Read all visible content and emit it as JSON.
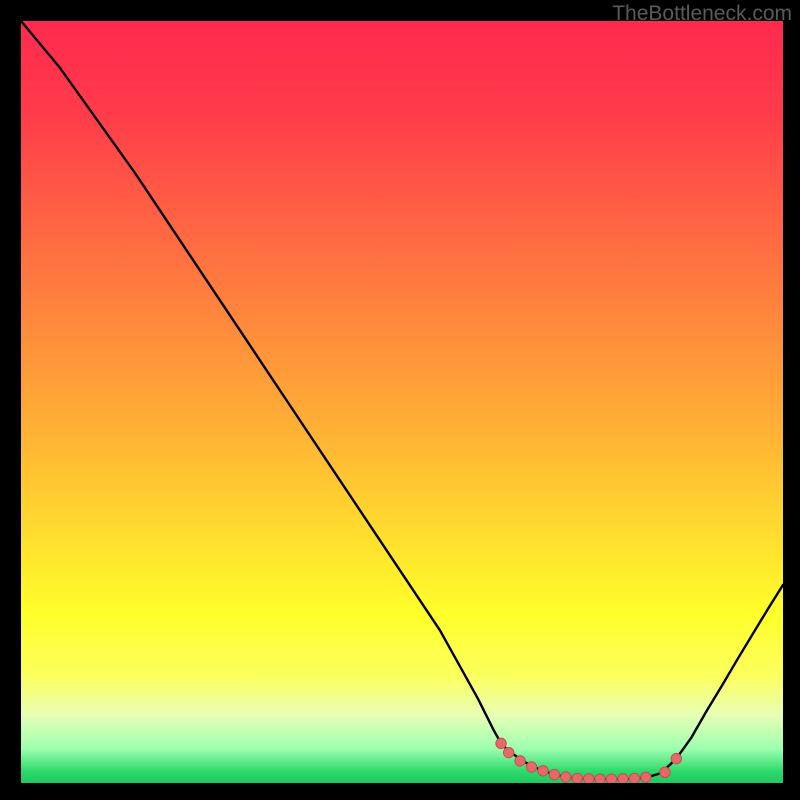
{
  "watermark": "TheBottleneck.com",
  "chart_data": {
    "type": "line",
    "title": "",
    "xlabel": "",
    "ylabel": "",
    "xlim": [
      0,
      100
    ],
    "ylim": [
      0,
      100
    ],
    "gradient_stops": [
      {
        "offset": 0.0,
        "color": "#ff2a4f"
      },
      {
        "offset": 0.12,
        "color": "#ff3b4a"
      },
      {
        "offset": 0.25,
        "color": "#ff6044"
      },
      {
        "offset": 0.4,
        "color": "#ff8a3c"
      },
      {
        "offset": 0.55,
        "color": "#ffb534"
      },
      {
        "offset": 0.68,
        "color": "#ffdf2e"
      },
      {
        "offset": 0.78,
        "color": "#ffff2a"
      },
      {
        "offset": 0.86,
        "color": "#fbff5e"
      },
      {
        "offset": 0.91,
        "color": "#e8ffb4"
      },
      {
        "offset": 0.955,
        "color": "#9cffb0"
      },
      {
        "offset": 0.985,
        "color": "#2dd96b"
      },
      {
        "offset": 1.0,
        "color": "#1fc95f"
      }
    ],
    "series": [
      {
        "name": "curve",
        "x": [
          0,
          5,
          10,
          15,
          20,
          25,
          30,
          35,
          40,
          45,
          50,
          55,
          60,
          62,
          63,
          64,
          66,
          68,
          70,
          72,
          74,
          76,
          78,
          80,
          82,
          84,
          86,
          88,
          90,
          92,
          94,
          96,
          98,
          100
        ],
        "y": [
          100,
          94,
          87,
          80,
          72.5,
          65,
          57.5,
          50,
          42.5,
          35,
          27.5,
          20,
          11,
          7,
          5.2,
          4.2,
          2.8,
          1.8,
          1.1,
          0.7,
          0.55,
          0.5,
          0.5,
          0.55,
          0.7,
          1.3,
          3.2,
          6.0,
          9.5,
          12.8,
          16.2,
          19.5,
          22.8,
          26
        ]
      }
    ],
    "markers": {
      "name": "flat-region",
      "color": "#e46a6a",
      "color_outline": "#c44e4e",
      "radius": 5.2,
      "points": [
        {
          "x": 63.0,
          "y": 5.2
        },
        {
          "x": 64.0,
          "y": 4.0
        },
        {
          "x": 65.5,
          "y": 2.9
        },
        {
          "x": 67.0,
          "y": 2.1
        },
        {
          "x": 68.5,
          "y": 1.6
        },
        {
          "x": 70.0,
          "y": 1.1
        },
        {
          "x": 71.5,
          "y": 0.8
        },
        {
          "x": 73.0,
          "y": 0.6
        },
        {
          "x": 74.5,
          "y": 0.55
        },
        {
          "x": 76.0,
          "y": 0.5
        },
        {
          "x": 77.5,
          "y": 0.5
        },
        {
          "x": 79.0,
          "y": 0.55
        },
        {
          "x": 80.5,
          "y": 0.6
        },
        {
          "x": 82.0,
          "y": 0.75
        },
        {
          "x": 84.5,
          "y": 1.4
        },
        {
          "x": 86.0,
          "y": 3.2
        }
      ]
    }
  }
}
